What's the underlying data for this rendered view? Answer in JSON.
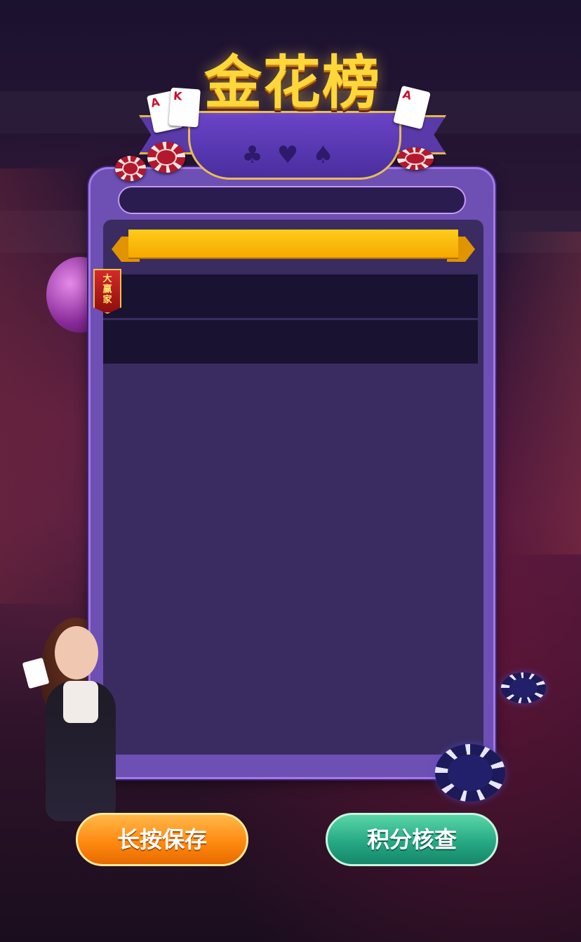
{
  "header": {
    "title": "金花榜",
    "suits": "♣♥♠",
    "card_left_1": "A",
    "card_left_2": "K",
    "card_right": "A"
  },
  "search": {
    "placeholder": ""
  },
  "leaderboard": {
    "banner_text": "",
    "winner_tag": "大\n赢\n家",
    "rows": [
      {
        "text": ""
      },
      {
        "text": ""
      }
    ]
  },
  "buttons": {
    "save_label": "长按保存",
    "check_label": "积分核查"
  },
  "colors": {
    "panel": "#6e4fb4",
    "inner": "#3a2c60",
    "banner": "#ffc21a",
    "save_button": "#ff8a10",
    "check_button": "#26a984",
    "title": "#ffd73a"
  },
  "icons": [
    "club-icon",
    "heart-icon",
    "spade-icon",
    "poker-chip-icon",
    "playing-card-icon"
  ]
}
